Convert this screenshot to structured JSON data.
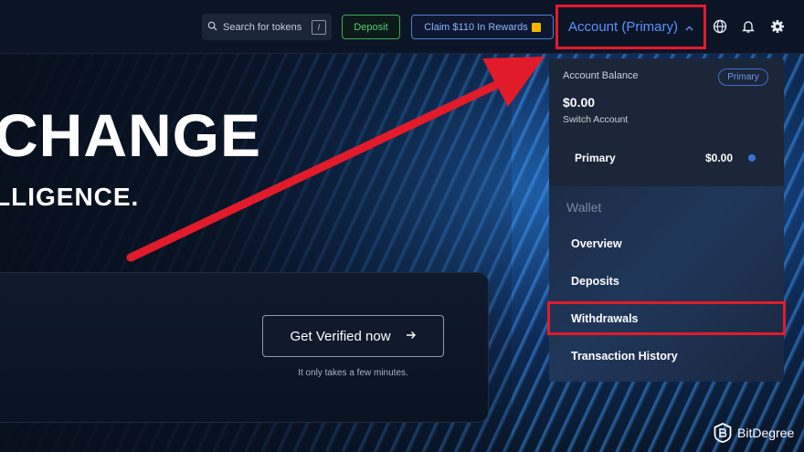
{
  "hero": {
    "title": "CHANGE",
    "subtitle": "LLIGENCE.",
    "verify_button": "Get Verified now",
    "verify_note": "It only takes a few minutes."
  },
  "topbar": {
    "search_placeholder": "Search for tokens",
    "search_shortcut": "/",
    "deposit_label": "Deposit",
    "claim_label": "Claim $110 In Rewards",
    "account_label": "Account (Primary)",
    "icons": [
      "search-icon",
      "gift-icon",
      "chevron-up-icon",
      "globe-icon",
      "bell-icon",
      "gear-icon"
    ]
  },
  "dropdown": {
    "balance_label": "Account Balance",
    "primary_badge": "Primary",
    "balance": "$0.00",
    "switch_label": "Switch Account",
    "account_name": "Primary",
    "account_amount": "$0.00",
    "wallet_label": "Wallet",
    "items": [
      "Overview",
      "Deposits",
      "Withdrawals",
      "Transaction History"
    ]
  },
  "annotations": {
    "highlight_color": "#e21b2b",
    "highlighted": [
      "Account (Primary)",
      "Withdrawals"
    ]
  },
  "watermark": {
    "text": "BitDegree"
  },
  "colors": {
    "accent": "#5d93ff",
    "deposit": "#57d06f",
    "page_bg": "#0a1424"
  }
}
